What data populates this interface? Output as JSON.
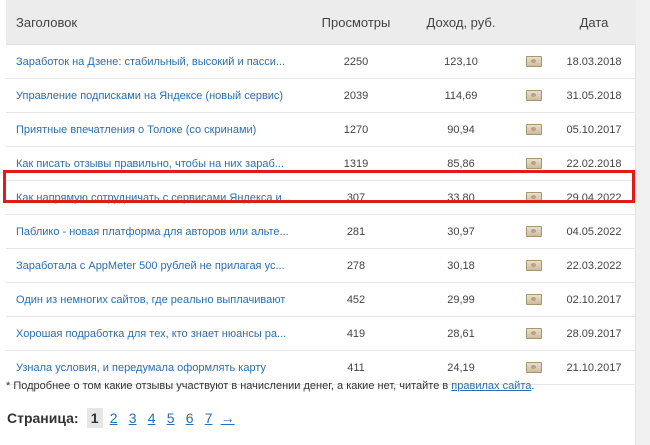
{
  "table": {
    "headers": {
      "title": "Заголовок",
      "views": "Просмотры",
      "income": "Доход, руб.",
      "date": "Дата"
    },
    "rows": [
      {
        "title": "Заработок на Дзене: стабильный, высокий и пасси...",
        "views": "2250",
        "income": "123,10",
        "date": "18.03.2018"
      },
      {
        "title": "Управление подписками на Яндексе (новый сервис)",
        "views": "2039",
        "income": "114,69",
        "date": "31.05.2018"
      },
      {
        "title": "Приятные впечатления о Толоке (со скринами)",
        "views": "1270",
        "income": "90,94",
        "date": "05.10.2017"
      },
      {
        "title": "Как писать отзывы правильно, чтобы на них зараб...",
        "views": "1319",
        "income": "85,86",
        "date": "22.02.2018"
      },
      {
        "title": "Как напрямую сотрудничать с сервисами Яндекса и...",
        "views": "307",
        "income": "33,80",
        "date": "29.04.2022"
      },
      {
        "title": "Паблико - новая платформа для авторов или альте...",
        "views": "281",
        "income": "30,97",
        "date": "04.05.2022"
      },
      {
        "title": "Заработала с AppMeter 500 рублей не прилагая ус...",
        "views": "278",
        "income": "30,18",
        "date": "22.03.2022"
      },
      {
        "title": "Один из немногих сайтов, где реально выплачивают",
        "views": "452",
        "income": "29,99",
        "date": "02.10.2017"
      },
      {
        "title": "Хорошая подработка для тех, кто знает нюансы ра...",
        "views": "419",
        "income": "28,61",
        "date": "28.09.2017"
      },
      {
        "title": "Узнала условия, и передумала оформлять карту",
        "views": "411",
        "income": "24,19",
        "date": "21.10.2017"
      }
    ]
  },
  "footnote": {
    "text": "* Подробнее о том какие отзывы участвуют в начислении денег, а какие нет, читайте в ",
    "link": "правилах сайта",
    "suffix": "."
  },
  "pager": {
    "label": "Страница:",
    "pages": [
      "1",
      "2",
      "3",
      "4",
      "5",
      "6",
      "7"
    ],
    "next": "→",
    "current": "1"
  },
  "colors": {
    "link": "#2a6fb0",
    "header_bg": "#ececec",
    "highlight": "#e11b1b"
  },
  "icons": {
    "income_icon": "banknote-icon"
  }
}
